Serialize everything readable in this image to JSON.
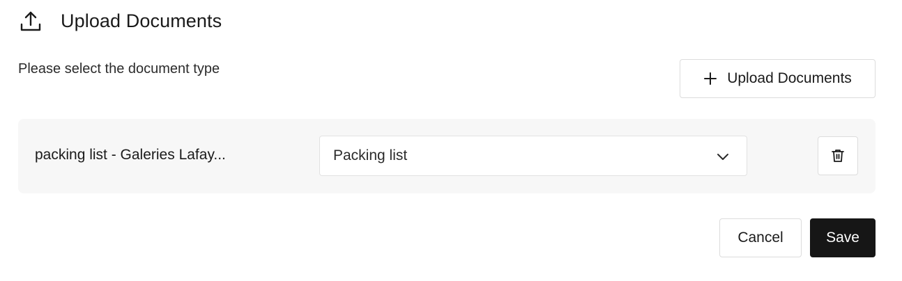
{
  "header": {
    "icon": "upload-icon",
    "title": "Upload Documents"
  },
  "instructions": "Please select the document type",
  "upload_button": {
    "icon": "plus-icon",
    "label": "Upload Documents"
  },
  "documents": [
    {
      "file_name": "packing list - Galeries Lafay...",
      "type_selected": "Packing list",
      "dropdown_icon": "chevron-down-icon",
      "delete_icon": "trash-icon"
    }
  ],
  "actions": {
    "cancel_label": "Cancel",
    "save_label": "Save"
  },
  "colors": {
    "primary": "#161616",
    "row_background": "#f7f7f7",
    "border": "#dcdcdc"
  }
}
